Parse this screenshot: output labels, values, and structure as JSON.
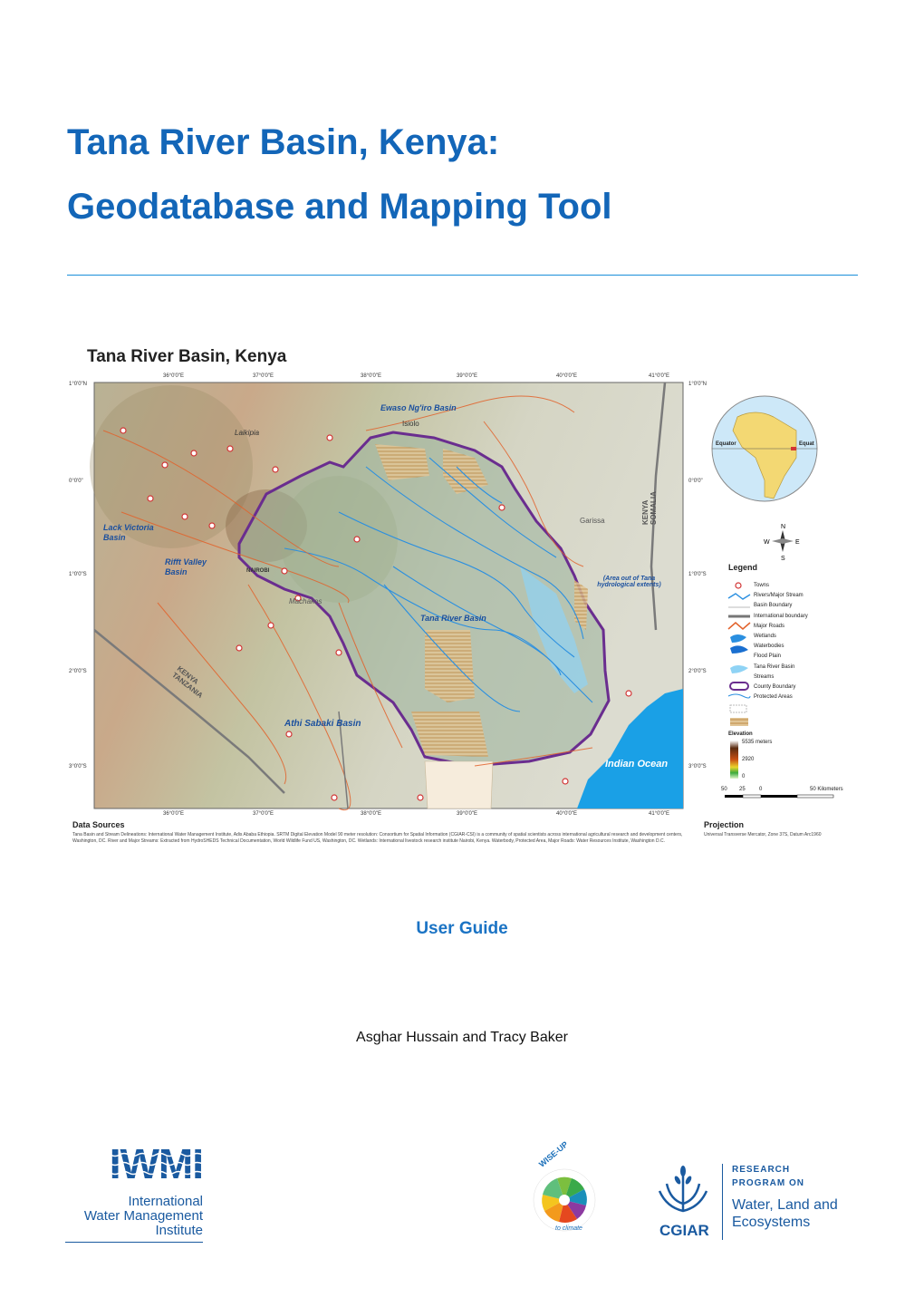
{
  "title": {
    "line1": "Tana River Basin, Kenya:",
    "line2": "Geodatabase and Mapping Tool"
  },
  "map": {
    "title": "Tana River Basin, Kenya",
    "lon_ticks": [
      "36°0'0\"E",
      "37°0'0\"E",
      "38°0'0\"E",
      "39°0'0\"E",
      "40°0'0\"E",
      "41°0'0\"E"
    ],
    "lat_ticks": [
      "1°0'0\"N",
      "0°0'0\"",
      "1°0'0\"S",
      "2°0'0\"S",
      "3°0'0\"S"
    ],
    "labels": {
      "ewaso": "Ewaso Ng'iro Basin",
      "lake_victoria": "Lack Victoria Basin",
      "rift": "Rifft Valley Basin",
      "tana": "Tana River Basin",
      "athi": "Athi Sabaki Basin",
      "indian_ocean": "Indian Ocean",
      "out_of_tana": "(Area out of Tana hydrological extents)",
      "kenya_tz": "KENYA TANZANIA",
      "kenya_so": "KENYA SOMALIA",
      "garissa": "Garissa",
      "machakos": "Machakos",
      "isiolo": "Isiolo",
      "laikipia": "Laikipia",
      "nairobi": "NAIROBI"
    },
    "globe": {
      "equator1": "Equator",
      "equator2": "Equat"
    },
    "legend": {
      "title": "Legend",
      "items": [
        "Towns",
        "Rivers/Major Stream",
        "Basin Boundary",
        "International boundary",
        "Major Roads",
        "Wetlands",
        "Waterbodies",
        "Flood Plain",
        "Tana River Basin",
        "Streams",
        "County Boundary",
        "Protected Areas"
      ],
      "elevation_title": "Elevation",
      "elev_high": "5535 meters",
      "elev_mid": "2920",
      "elev_low": "0"
    },
    "scale": [
      "50",
      "25",
      "0",
      "50 Kilometers"
    ],
    "data_sources_title": "Data Sources",
    "data_sources_text": "Tana Basin and Stream Delineations: International Water Management Institute, Adis Ababa Ethiopia. SRTM Digital Elevation Model 90 meter resolution: Consortium for Spatial Information (CGIAR-CSI) is a community of spatial scientists across international agricultural research and development centers, Washington, DC. River and Major Streams: Extracted from HydroSHEDS Technical Documentation, World Wildlife Fund US, Washington, DC. Wetlands: International livestock research institute Nairobi, Kenya. Waterbody, Protected Area, Major Roads: Water Resources Institute, Washington D.C.",
    "projection_title": "Projection",
    "projection_text": "Universal Transverse Mercator, Zone 37S, Datum Arc1960"
  },
  "subtitle": "User Guide",
  "authors": "Asghar Hussain and Tracy Baker",
  "logos": {
    "iwmi_mark": "IWMI",
    "iwmi_line1": "International",
    "iwmi_line2": "Water Management",
    "iwmi_line3": "Institute",
    "wiseup": "WISE-UP",
    "wiseup_sub": "to climate",
    "cgiar": "CGIAR",
    "wle_line1": "RESEARCH",
    "wle_line2": "PROGRAM ON",
    "wle_line3": "Water, Land and",
    "wle_line4": "Ecosystems"
  },
  "colors": {
    "title_blue": "#1366b8",
    "ocean": "#1aa0e6",
    "basin_outline": "#6a2d8f",
    "wle_blue": "#1a5aa0"
  }
}
